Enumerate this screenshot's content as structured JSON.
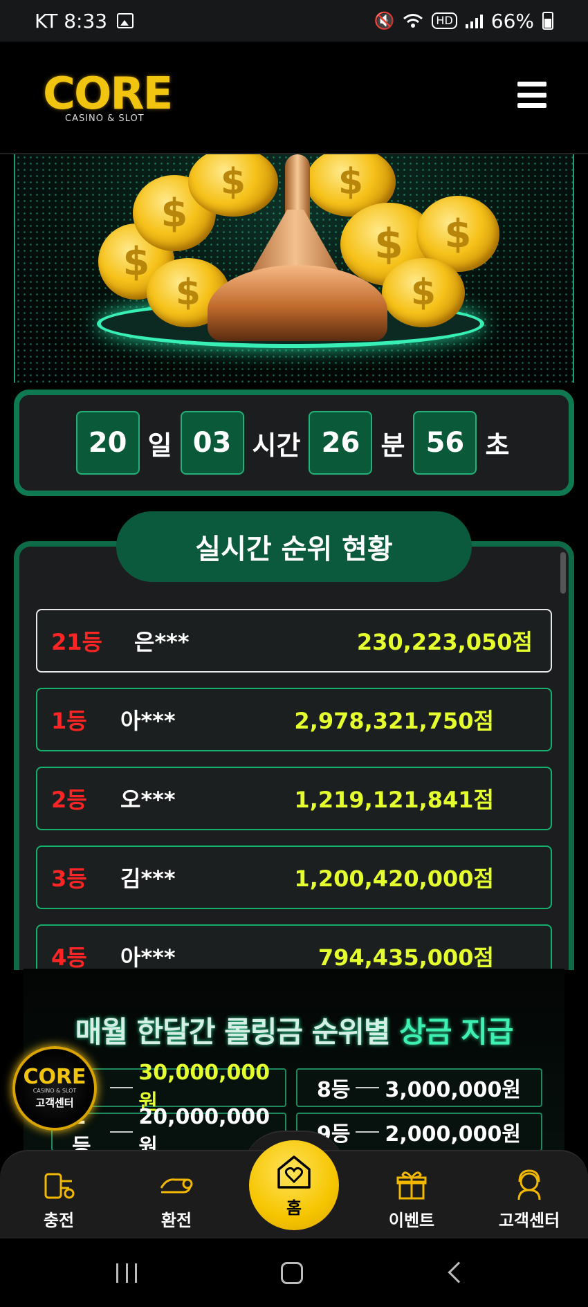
{
  "status_bar": {
    "carrier_time": "KT 8:33",
    "hd": "HD",
    "battery": "66%"
  },
  "header": {
    "logo_main": "CORE",
    "logo_sub": "CASINO & SLOT"
  },
  "countdown": {
    "days": "20",
    "days_unit": "일",
    "hours": "03",
    "hours_unit": "시간",
    "minutes": "26",
    "minutes_unit": "분",
    "seconds": "56",
    "seconds_unit": "초"
  },
  "ranking": {
    "title": "실시간 순위 현황",
    "my_rank": {
      "rank": "21등",
      "name": "은***",
      "score": "230,223,050점"
    },
    "rows": [
      {
        "rank": "1등",
        "name": "아***",
        "score": "2,978,321,750점"
      },
      {
        "rank": "2등",
        "name": "오***",
        "score": "1,219,121,841점"
      },
      {
        "rank": "3등",
        "name": "김***",
        "score": "1,200,420,000점"
      },
      {
        "rank": "4등",
        "name": "아***",
        "score": "794,435,000점"
      }
    ]
  },
  "prize": {
    "title_part1": "매월 한달간 롤링금 순위별 ",
    "title_part2": "상금 지급",
    "cells": [
      {
        "rank": "1등",
        "amount": "30,000,000원"
      },
      {
        "rank": "8등",
        "amount": "3,000,000원"
      },
      {
        "rank": "2등",
        "amount": "20,000,000원"
      },
      {
        "rank": "9등",
        "amount": "2,000,000원"
      }
    ]
  },
  "support_badge": {
    "logo": "CORE",
    "sub": "CASINO & SLOT",
    "label": "고객센터"
  },
  "bottom_nav": {
    "charge": "충전",
    "exchange": "환전",
    "home": "홈",
    "event": "이벤트",
    "support": "고객센터"
  },
  "colors": {
    "accent_green": "#0f7a52",
    "rank_red": "#ff2525",
    "score_yellow": "#e5ff2e",
    "home_yellow": "#f6c500"
  }
}
